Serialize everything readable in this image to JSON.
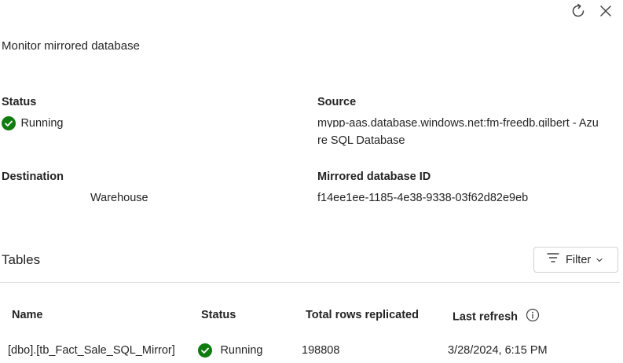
{
  "panel": {
    "title": "Monitor mirrored database",
    "refresh_icon": "refresh-icon",
    "close_icon": "close-icon"
  },
  "details": {
    "status_label": "Status",
    "status_value": "Running",
    "status_icon": "check-circle-icon",
    "status_color": "#107c10",
    "source_label": "Source",
    "source_value_line1": "mypp-aas.database.windows.net:fm-freedb.gilbert - Azu",
    "source_value_line2": "re SQL Database",
    "destination_label": "Destination",
    "destination_value": "Warehouse",
    "mirror_id_label": "Mirrored database ID",
    "mirror_id_value": "f14ee1ee-1185-4e38-9338-03f62d82e9eb"
  },
  "tables": {
    "title": "Tables",
    "filter_label": "Filter",
    "filter_icon": "filter-icon",
    "chevron_icon": "chevron-down-icon",
    "columns": {
      "name": "Name",
      "status": "Status",
      "rows": "Total rows replicated",
      "last_refresh": "Last refresh",
      "info_icon": "info-icon"
    },
    "rows": [
      {
        "name": "[dbo].[tb_Fact_Sale_SQL_Mirror]",
        "status": "Running",
        "total_rows": "198808",
        "last_refresh": "3/28/2024, 6:15 PM"
      }
    ]
  }
}
